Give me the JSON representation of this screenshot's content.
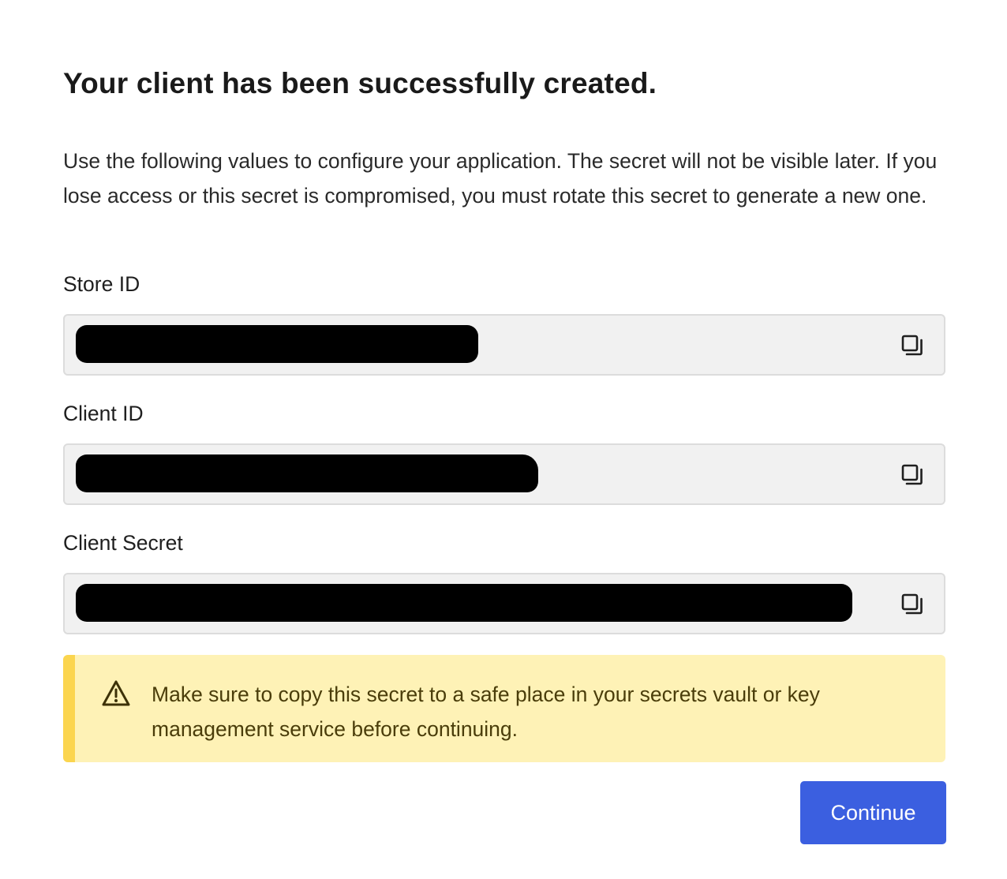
{
  "dialog": {
    "title": "Your client has been successfully created.",
    "description": "Use the following values to configure your application. The secret will not be visible later. If you lose access or this secret is compromised, you must rotate this secret to generate a new one."
  },
  "fields": [
    {
      "label": "Store ID",
      "value_state": "redacted",
      "copy_icon": "copy-icon"
    },
    {
      "label": "Client ID",
      "value_state": "redacted",
      "copy_icon": "copy-icon"
    },
    {
      "label": "Client Secret",
      "value_state": "redacted",
      "copy_icon": "copy-icon"
    }
  ],
  "warning": {
    "icon": "warning-triangle-icon",
    "text": "Make sure to copy this secret to a safe place in your secrets vault or key management service before continuing."
  },
  "actions": {
    "continue_label": "Continue"
  },
  "colors": {
    "primary_button": "#3b5fe0",
    "warning_bg": "#fef2b6",
    "warning_accent": "#fbd54f",
    "field_bg": "#f1f1f1"
  }
}
